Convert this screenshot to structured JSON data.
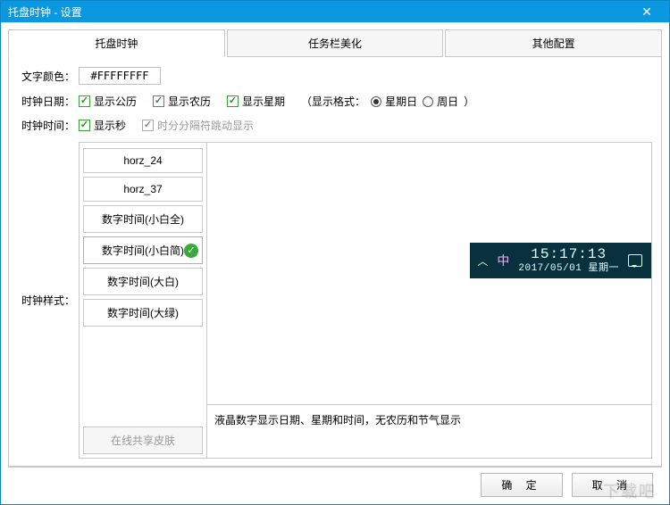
{
  "window": {
    "title": "托盘时钟 - 设置"
  },
  "tabs": [
    {
      "label": "托盘时钟",
      "active": true
    },
    {
      "label": "任务栏美化",
      "active": false
    },
    {
      "label": "其他配置",
      "active": false
    }
  ],
  "labels": {
    "text_color": "文字颜色：",
    "clock_date": "时钟日期：",
    "clock_time": "时钟时间：",
    "clock_style": "时钟样式："
  },
  "text_color_value": "#FFFFFFFF",
  "date_opts": {
    "gregorian": "显示公历",
    "lunar": "显示农历",
    "weekday": "显示星期",
    "fmt_label": "（显示格式：",
    "fmt_opt1": "星期日",
    "fmt_opt2": "周日",
    "close_paren": "）"
  },
  "time_opts": {
    "seconds": "显示秒",
    "blink": "时分分隔符跳动显示"
  },
  "styles": [
    {
      "label": "horz_24"
    },
    {
      "label": "horz_37"
    },
    {
      "label": "数字时间(小白全)"
    },
    {
      "label": "数字时间(小白简)",
      "selected": true
    },
    {
      "label": "数字时间(大白)"
    },
    {
      "label": "数字时间(大绿)"
    }
  ],
  "share_btn": "在线共享皮肤",
  "preview": {
    "ime": "中",
    "time": "15:17:13",
    "date": "2017/05/01 星期一"
  },
  "desc": "液晶数字显示日期、星期和时间，无农历和节气显示",
  "buttons": {
    "ok": "确 定",
    "cancel": "取 消"
  },
  "watermark": "下载吧"
}
